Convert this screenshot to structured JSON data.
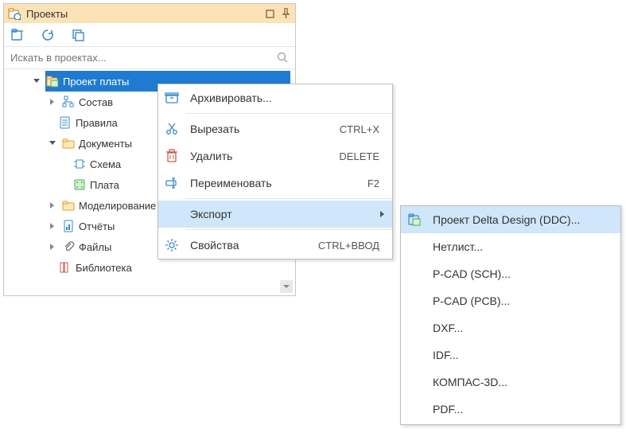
{
  "panel": {
    "title": "Проекты",
    "search_placeholder": "Искать в проектах..."
  },
  "tree": {
    "root": {
      "label": "Проект платы"
    },
    "items": [
      {
        "label": "Состав"
      },
      {
        "label": "Правила"
      },
      {
        "label": "Документы"
      },
      {
        "label": "Схема"
      },
      {
        "label": "Плата"
      },
      {
        "label": "Моделирование"
      },
      {
        "label": "Отчёты"
      },
      {
        "label": "Файлы"
      },
      {
        "label": "Библиотека"
      }
    ]
  },
  "context_menu": {
    "archive": "Архивировать...",
    "cut": {
      "label": "Вырезать",
      "shortcut": "CTRL+X"
    },
    "delete": {
      "label": "Удалить",
      "shortcut": "DELETE"
    },
    "rename": {
      "label": "Переименовать",
      "shortcut": "F2"
    },
    "export": "Экспорт",
    "properties": {
      "label": "Свойства",
      "shortcut": "CTRL+ВВОД"
    }
  },
  "export_submenu": [
    "Проект Delta Design (DDC)...",
    "Нетлист...",
    "P-CAD (SCH)...",
    "P-CAD (PCB)...",
    "DXF...",
    "IDF...",
    "КОМПАС-3D...",
    "PDF..."
  ]
}
